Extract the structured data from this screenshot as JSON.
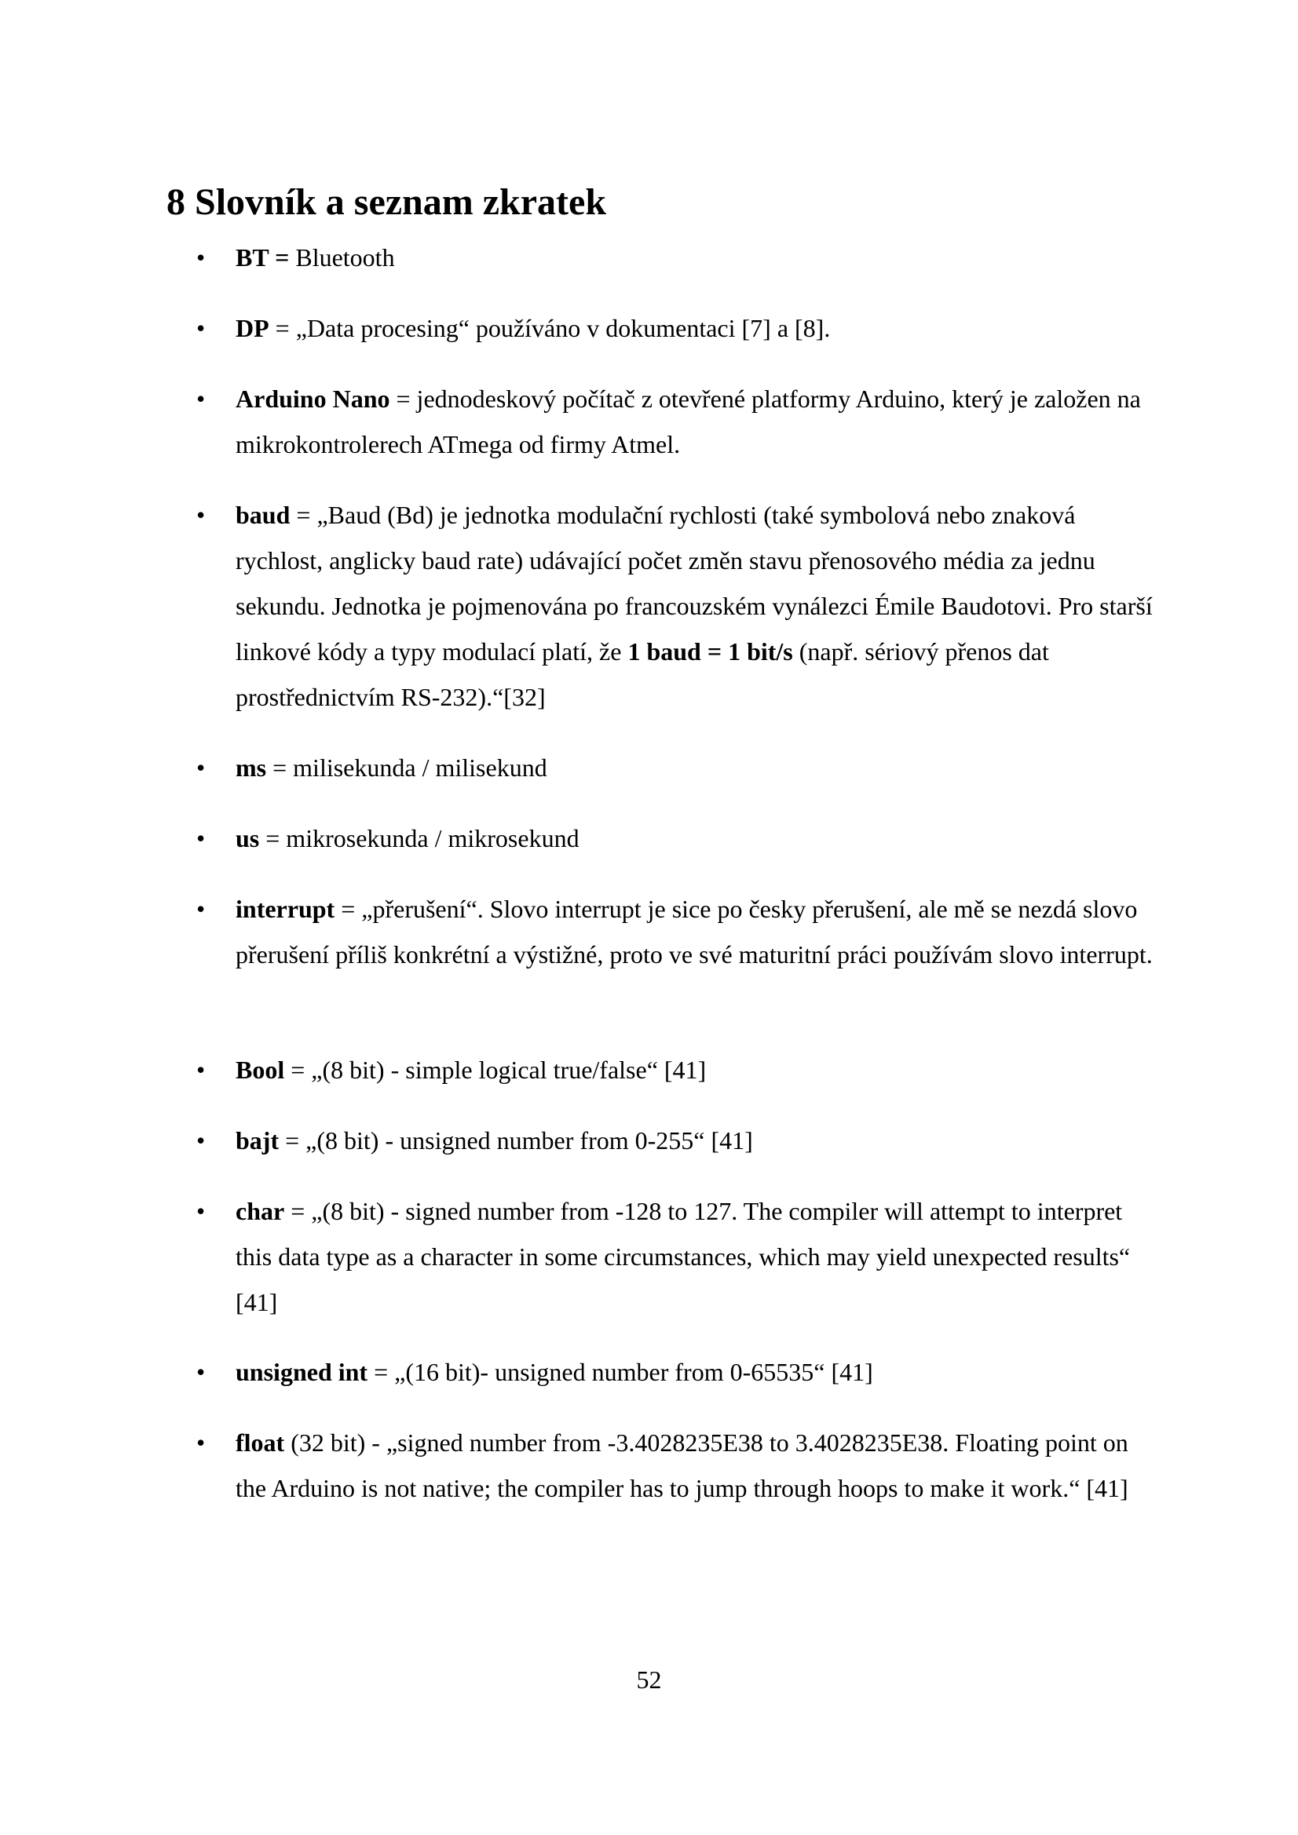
{
  "heading": "8 Slovník a seznam zkratek",
  "bullet_char": "•",
  "items": [
    {
      "term": "BT =",
      "text": " Bluetooth"
    },
    {
      "term": "DP",
      "text": " = „Data procesing“ používáno v dokumentaci [7] a [8]."
    },
    {
      "term": "Arduino Nano",
      "text": " = jednodeskový počítač z otevřené platformy Arduino, který je založen na mikrokontrolerech ATmega od firmy Atmel."
    },
    {
      "term": "baud",
      "text": " = „Baud (Bd) je jednotka modulační rychlosti (také symbolová nebo znaková rychlost, anglicky baud rate) udávající počet změn stavu přenosového média za jednu sekundu. Jednotka je pojmenována po francouzském vynálezci Émile Baudotovi. Pro starší linkové kódy a typy modulací platí, že ",
      "strong": "1 baud = 1 bit/s",
      "text2": " (např. sériový přenos dat prostřednictvím RS-232).“[32]"
    },
    {
      "term": "ms",
      "text": " = milisekunda / milisekund"
    },
    {
      "term": "us",
      "text": " = mikrosekunda / mikrosekund"
    },
    {
      "term": "interrupt",
      "text": " = „přerušení“. Slovo interrupt je sice po česky přerušení, ale mě se nezdá slovo přerušení příliš konkrétní a výstižné, proto ve své maturitní práci používám slovo interrupt."
    },
    {
      "term": "Bool",
      "text": " = „(8 bit) - simple logical true/false“ [41]"
    },
    {
      "term": "bajt",
      "text": " = „(8 bit) - unsigned number from 0-255“ [41]"
    },
    {
      "term": "char",
      "text": " = „(8 bit) - signed number from -128 to 127. The compiler will attempt to interpret this data type as a character in some circumstances, which may yield unexpected results“ [41]"
    },
    {
      "term": "unsigned int",
      "text": " = „(16 bit)- unsigned number from 0-65535“ [41]"
    },
    {
      "term": "float",
      "text": " (32 bit) - „signed number from -3.4028235E38 to 3.4028235E38. Floating point on the Arduino is not native; the compiler has to jump through hoops to make it work.“ [41]"
    }
  ],
  "page_number": "52"
}
